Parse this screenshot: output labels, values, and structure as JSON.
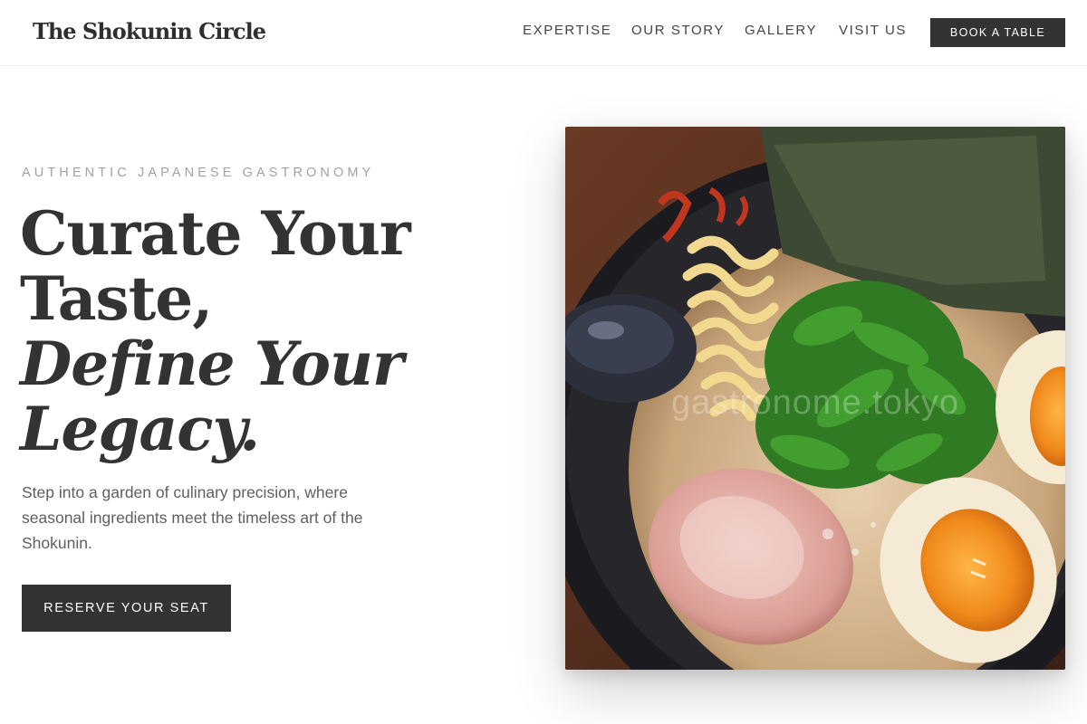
{
  "header": {
    "brand": "The Shokunin Circle",
    "nav": [
      {
        "label": "EXPERTISE"
      },
      {
        "label": "OUR STORY"
      },
      {
        "label": "GALLERY"
      },
      {
        "label": "VISIT US"
      }
    ],
    "book_label": "BOOK A TABLE"
  },
  "hero": {
    "eyebrow": "AUTHENTIC JAPANESE GASTRONOMY",
    "headline_line1": "Curate Your",
    "headline_line2": "Taste,",
    "headline_line3": "Define Your",
    "headline_line4": "Legacy.",
    "lede": "Step into a garden of culinary precision, where seasonal ingredients meet the timeless art of the Shokunin.",
    "cta_label": "RESERVE YOUR SEAT",
    "image_watermark": "gastronome.tokyo"
  },
  "colors": {
    "accent": "#333333",
    "eyebrow": "#a3a3a3",
    "body_text": "#5f5f5f",
    "background": "#ffffff"
  }
}
